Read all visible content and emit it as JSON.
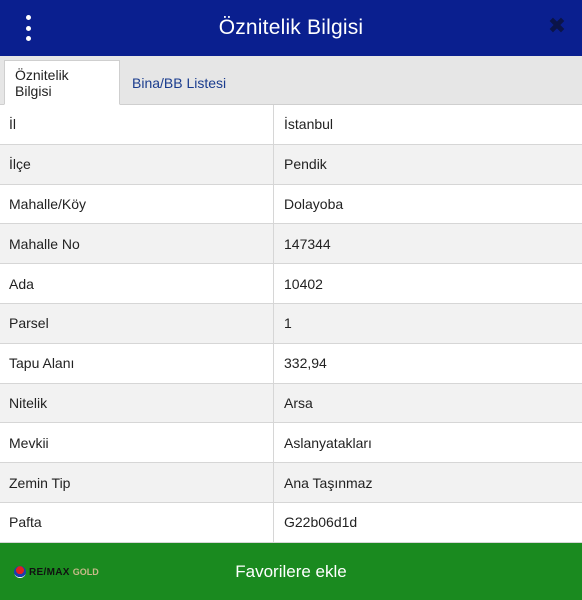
{
  "header": {
    "title": "Öznitelik Bilgisi",
    "menu_icon": "kebab-menu-icon",
    "close_icon": "close-icon",
    "background_color": "#0a1f8f"
  },
  "tabs": [
    {
      "label": "Öznitelik Bilgisi",
      "active": true
    },
    {
      "label": "Bina/BB Listesi",
      "active": false
    }
  ],
  "attributes": [
    {
      "key": "İl",
      "value": "İstanbul"
    },
    {
      "key": "İlçe",
      "value": "Pendik"
    },
    {
      "key": "Mahalle/Köy",
      "value": "Dolayoba"
    },
    {
      "key": "Mahalle No",
      "value": "147344"
    },
    {
      "key": "Ada",
      "value": "10402"
    },
    {
      "key": "Parsel",
      "value": "1"
    },
    {
      "key": "Tapu Alanı",
      "value": "332,94"
    },
    {
      "key": "Nitelik",
      "value": "Arsa"
    },
    {
      "key": "Mevkii",
      "value": "Aslanyatakları"
    },
    {
      "key": "Zemin Tip",
      "value": "Ana Taşınmaz"
    },
    {
      "key": "Pafta",
      "value": "G22b06d1d"
    }
  ],
  "footer": {
    "button_label": "Favorilere ekle",
    "logo_text": "RE/MAX",
    "logo_suffix": "GOLD",
    "background_color": "#1a8a1f"
  }
}
